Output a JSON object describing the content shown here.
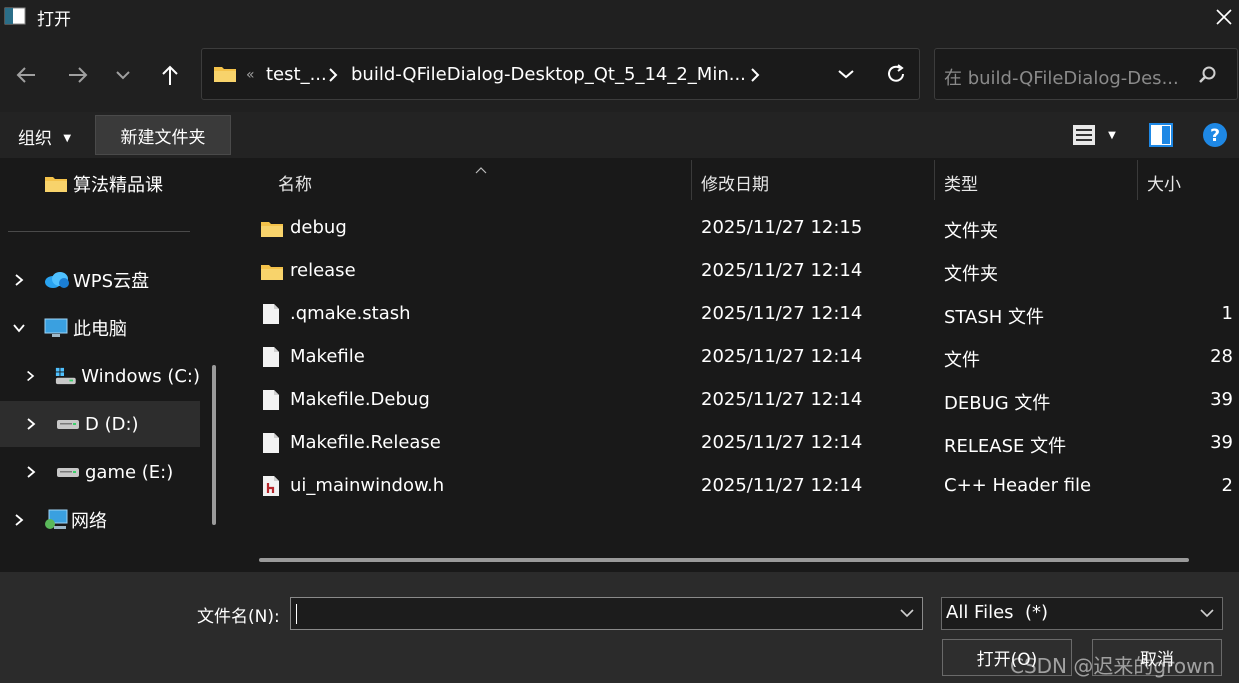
{
  "window": {
    "title": "打开"
  },
  "address": {
    "overflow": "«",
    "crumbs": [
      "test_...",
      "build-QFileDialog-Desktop_Qt_5_14_2_Min..."
    ]
  },
  "search": {
    "placeholder": "在 build-QFileDialog-Des..."
  },
  "toolbar": {
    "organize": "组织",
    "new_folder": "新建文件夹"
  },
  "sidebar": {
    "items": [
      {
        "label": "算法精品课",
        "icon": "folder-icon"
      },
      {
        "label": "WPS云盘",
        "icon": "cloud-icon"
      },
      {
        "label": "此电脑",
        "icon": "computer-icon"
      },
      {
        "label": "Windows (C:)",
        "icon": "windows-drive-icon"
      },
      {
        "label": "D (D:)",
        "icon": "drive-icon"
      },
      {
        "label": "game (E:)",
        "icon": "drive-icon"
      },
      {
        "label": "网络",
        "icon": "network-icon"
      }
    ]
  },
  "columns": {
    "name": "名称",
    "date": "修改日期",
    "type": "类型",
    "size": "大小"
  },
  "files": [
    {
      "name": "debug",
      "date": "2025/11/27 12:15",
      "type": "文件夹",
      "size": "",
      "icon": "folder-icon"
    },
    {
      "name": "release",
      "date": "2025/11/27 12:14",
      "type": "文件夹",
      "size": "",
      "icon": "folder-icon"
    },
    {
      "name": ".qmake.stash",
      "date": "2025/11/27 12:14",
      "type": "STASH 文件",
      "size": "1",
      "icon": "file-icon"
    },
    {
      "name": "Makefile",
      "date": "2025/11/27 12:14",
      "type": "文件",
      "size": "28",
      "icon": "file-icon"
    },
    {
      "name": "Makefile.Debug",
      "date": "2025/11/27 12:14",
      "type": "DEBUG 文件",
      "size": "39",
      "icon": "file-icon"
    },
    {
      "name": "Makefile.Release",
      "date": "2025/11/27 12:14",
      "type": "RELEASE 文件",
      "size": "39",
      "icon": "file-icon"
    },
    {
      "name": "ui_mainwindow.h",
      "date": "2025/11/27 12:14",
      "type": "C++ Header file",
      "size": "2",
      "icon": "header-file-icon"
    }
  ],
  "footer": {
    "filename_label": "文件名(N):",
    "filename_value": "",
    "filetype": "All Files  (*)",
    "open": "打开(O)",
    "cancel": "取消"
  },
  "watermark": "CSDN @迟来的grown",
  "colors": {
    "accent": "#0a84ff",
    "folder": "#f4c24a",
    "help": "#1e88e5"
  }
}
